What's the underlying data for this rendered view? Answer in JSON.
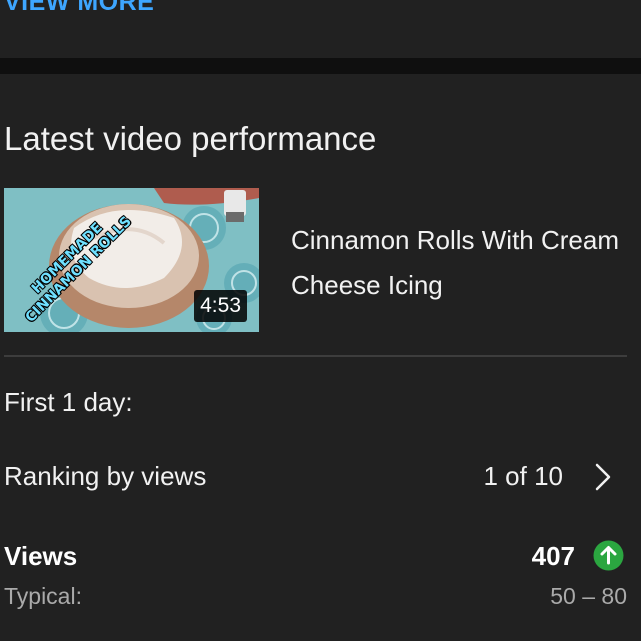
{
  "top_card": {
    "view_more_label": "VIEW MORE"
  },
  "latest_video": {
    "section_title": "Latest video performance",
    "thumbnail_text": "HOMEMADE CINNAMON ROLLS",
    "duration": "4:53",
    "title": "Cinnamon Rolls With Cream Cheese Icing"
  },
  "metrics": {
    "period_label": "First 1 day:",
    "ranking_label": "Ranking by views",
    "ranking_value": "1 of 10",
    "views_label": "Views",
    "views_value": "407",
    "typical_label": "Typical:",
    "typical_value": "50 – 80"
  },
  "colors": {
    "background": "#212121",
    "link_blue": "#3ea6ff",
    "up_green": "#2ba640",
    "secondary_text": "#aaaaaa"
  },
  "icons": {
    "chevron": "chevron-right-icon",
    "trend": "arrow-up-circle-icon"
  }
}
